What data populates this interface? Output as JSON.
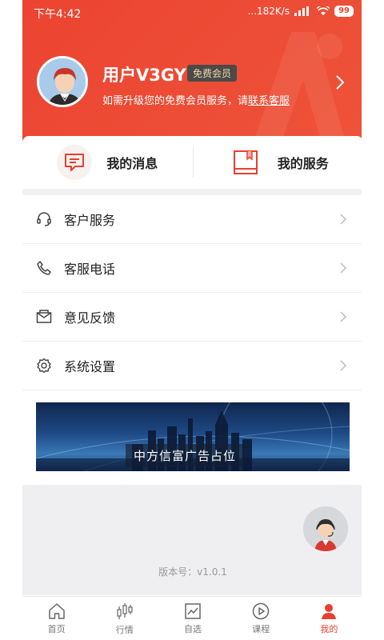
{
  "status_bar": {
    "time": "下午4:42",
    "network": "...182K/s",
    "battery": "99"
  },
  "profile": {
    "username": "用户V3GY",
    "badge": "免费会员",
    "hint_prefix": "如需升级您的免费会员服务，请",
    "hint_link": "联系客服"
  },
  "quick_actions": [
    {
      "label": "我的消息",
      "icon": "message-icon"
    },
    {
      "label": "我的服务",
      "icon": "bookmark-icon"
    }
  ],
  "menu": [
    {
      "label": "客户服务",
      "icon": "headset-icon"
    },
    {
      "label": "客服电话",
      "icon": "phone-icon"
    },
    {
      "label": "意见反馈",
      "icon": "mail-icon"
    },
    {
      "label": "系统设置",
      "icon": "gear-icon"
    }
  ],
  "banner": {
    "text": "中方信富广告占位"
  },
  "version": "版本号：v1.0.1",
  "tabs": [
    {
      "label": "首页",
      "icon": "home-icon",
      "active": false
    },
    {
      "label": "行情",
      "icon": "candlestick-icon",
      "active": false
    },
    {
      "label": "自选",
      "icon": "chart-icon",
      "active": false
    },
    {
      "label": "课程",
      "icon": "play-icon",
      "active": false
    },
    {
      "label": "我的",
      "icon": "person-icon",
      "active": true
    }
  ],
  "colors": {
    "brand": "#ec4431",
    "active_tab": "#e8402f",
    "badge_bg": "#4a4a4a",
    "badge_text": "#f0d9a8"
  }
}
